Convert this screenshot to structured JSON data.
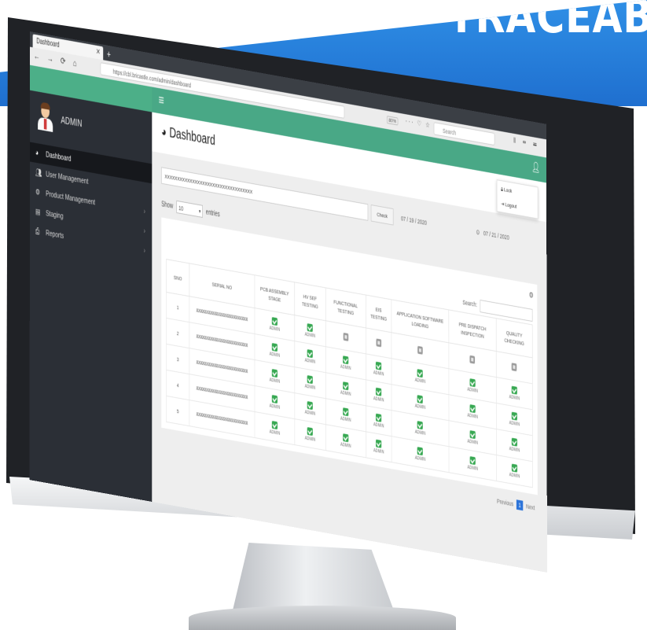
{
  "banner": {
    "text": "TRACEAB"
  },
  "browser": {
    "tab_title": "Dashboard",
    "url": "https://cbl.bricastle.com/admin/dashboard",
    "zoom": "80%",
    "search_placeholder": "Search"
  },
  "sidebar": {
    "user_name": "ADMIN",
    "items": [
      {
        "label": "Dashboard",
        "icon": "dashboard-icon",
        "active": true,
        "has_submenu": false
      },
      {
        "label": "User Management",
        "icon": "users-icon",
        "active": false,
        "has_submenu": false
      },
      {
        "label": "Product Management",
        "icon": "gear-icon",
        "active": false,
        "has_submenu": true
      },
      {
        "label": "Staging",
        "icon": "staging-icon",
        "active": false,
        "has_submenu": true
      },
      {
        "label": "Reports",
        "icon": "print-icon",
        "active": false,
        "has_submenu": true
      }
    ]
  },
  "header": {
    "title": "Dashboard",
    "menu": [
      {
        "label": "Lock",
        "icon": "lock-icon"
      },
      {
        "label": "Logout",
        "icon": "logout-icon"
      }
    ]
  },
  "filter": {
    "serial_value": "XXXXXXXXXXXXXXXXXXXXXXXXXXXXXXXXXXX",
    "check_label": "Check",
    "date_from": "07 / 19 / 2020",
    "date_to": "07 / 21 / 2020"
  },
  "table": {
    "show_label": "Show",
    "entries_value": "10",
    "entries_label": "entries",
    "search_label": "Search:",
    "columns": [
      "SNO",
      "SERIAL NO",
      "PCB ASSEMBLY STAGE",
      "HV SEF TESTING",
      "FUNCTIONAL TESTING",
      "EIS TESTING",
      "APPLICATION SOFTWARE LOADING",
      "PRE DISPATCH INSPECTION",
      "QUALITY CHECKING"
    ],
    "rows": [
      {
        "sno": "1",
        "serial": "XXXXXXXXXXXXXXXXXXXXXXXXXX",
        "stages": [
          "done",
          "done",
          "pending",
          "pending",
          "pending",
          "pending",
          "pending"
        ]
      },
      {
        "sno": "2",
        "serial": "XXXXXXXXXXXXXXXXXXXXXXXXXX",
        "stages": [
          "done",
          "done",
          "done",
          "done",
          "done",
          "done",
          "done"
        ]
      },
      {
        "sno": "3",
        "serial": "XXXXXXXXXXXXXXXXXXXXXXXXXX",
        "stages": [
          "done",
          "done",
          "done",
          "done",
          "done",
          "done",
          "done"
        ]
      },
      {
        "sno": "4",
        "serial": "XXXXXXXXXXXXXXXXXXXXXXXXXX",
        "stages": [
          "done",
          "done",
          "done",
          "done",
          "done",
          "done",
          "done"
        ]
      },
      {
        "sno": "5",
        "serial": "XXXXXXXXXXXXXXXXXXXXXXXXXX",
        "stages": [
          "done",
          "done",
          "done",
          "done",
          "done",
          "done",
          "done"
        ]
      }
    ],
    "done_label": "ADMIN"
  },
  "pagination": {
    "previous": "Previous",
    "current": "1",
    "next": "Next"
  },
  "colors": {
    "accent_green": "#49a886",
    "sidebar_bg": "#2b2f36",
    "banner_blue": "#1f6fcf",
    "check_green": "#37a852",
    "page_blue": "#2d74d9"
  }
}
